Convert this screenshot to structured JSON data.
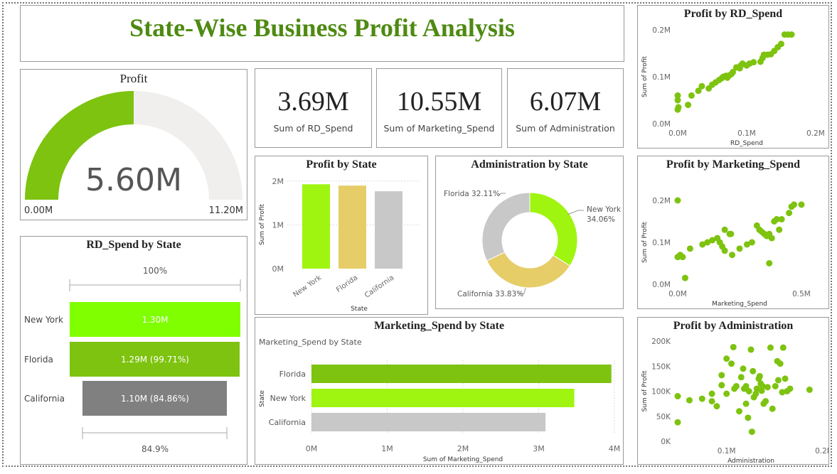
{
  "header": {
    "title": "State-Wise Business Profit Analysis"
  },
  "colors": {
    "accent": "#7dc30f",
    "bright_green": "#9ff510",
    "light_green": "#7fff00",
    "yellow": "#e6cd68",
    "gray": "#c8c8c8",
    "dark_gray": "#808080",
    "title_green": "#4e8a12"
  },
  "gauge": {
    "title": "Profit",
    "value_label": "5.60M",
    "min_label": "0.00M",
    "max_label": "11.20M",
    "fraction": 0.5
  },
  "kpis": [
    {
      "value": "3.69M",
      "label": "Sum of RD_Spend"
    },
    {
      "value": "10.55M",
      "label": "Sum of Marketing_Spend"
    },
    {
      "value": "6.07M",
      "label": "Sum of Administration"
    }
  ],
  "funnel": {
    "title": "RD_Spend by State",
    "top_label": "100%",
    "bottom_label": "84.9%",
    "rows": [
      {
        "state": "New York",
        "label": "1.30M",
        "fraction": 1.0
      },
      {
        "state": "Florida",
        "label": "1.29M (99.71%)",
        "fraction": 0.9971
      },
      {
        "state": "California",
        "label": "1.10M (84.86%)",
        "fraction": 0.8486
      }
    ]
  },
  "chart_data": [
    {
      "id": "profit_by_state",
      "type": "bar",
      "title": "Profit by State",
      "categories": [
        "New York",
        "Florida",
        "California"
      ],
      "values": [
        1.93,
        1.9,
        1.77
      ],
      "xlabel": "State",
      "ylabel": "Sum of Profit",
      "ylim": [
        0,
        2
      ],
      "yticks": [
        "0M",
        "1M",
        "2M"
      ],
      "colors": [
        "#9ff510",
        "#e6cd68",
        "#c8c8c8"
      ]
    },
    {
      "id": "admin_by_state",
      "type": "pie",
      "title": "Administration by State",
      "slices": [
        {
          "label": "New York",
          "percent": 34.06,
          "percent_label": "34.06%",
          "color": "#9ff510"
        },
        {
          "label": "California",
          "percent": 33.83,
          "percent_label": "California 33.83%",
          "color": "#e6cd68"
        },
        {
          "label": "Florida",
          "percent": 32.11,
          "percent_label": "Florida 32.11%",
          "color": "#c8c8c8"
        }
      ]
    },
    {
      "id": "marketing_by_state",
      "type": "bar",
      "orientation": "horizontal",
      "title": "Marketing_Spend by State",
      "subtitle": "Marketing_Spend by State",
      "categories": [
        "Florida",
        "New York",
        "California"
      ],
      "values": [
        3.96,
        3.47,
        3.09
      ],
      "xlabel": "Sum of Marketing_Spend",
      "ylabel": "State",
      "xlim": [
        0,
        4
      ],
      "xticks": [
        "0M",
        "1M",
        "2M",
        "3M",
        "4M"
      ],
      "colors": [
        "#7dc30f",
        "#9ff510",
        "#c8c8c8"
      ]
    },
    {
      "id": "profit_by_rd",
      "type": "scatter",
      "title": "Profit by RD_Spend",
      "xlabel": "RD_Spend",
      "ylabel": "Sum of Profit",
      "xlim": [
        0,
        0.2
      ],
      "ylim": [
        0,
        0.2
      ],
      "xticks": [
        "0.0M",
        "0.1M",
        "0.2M"
      ],
      "yticks": [
        "0.0M",
        "0.1M",
        "0.2M"
      ],
      "points": [
        [
          0,
          0.03
        ],
        [
          0,
          0.05
        ],
        [
          0,
          0.06
        ],
        [
          0.001,
          0.035
        ],
        [
          0.015,
          0.04
        ],
        [
          0.02,
          0.06
        ],
        [
          0.03,
          0.07
        ],
        [
          0.035,
          0.08
        ],
        [
          0.045,
          0.075
        ],
        [
          0.05,
          0.083
        ],
        [
          0.055,
          0.088
        ],
        [
          0.06,
          0.093
        ],
        [
          0.064,
          0.097
        ],
        [
          0.066,
          0.1
        ],
        [
          0.07,
          0.102
        ],
        [
          0.072,
          0.098
        ],
        [
          0.075,
          0.103
        ],
        [
          0.078,
          0.106
        ],
        [
          0.08,
          0.11
        ],
        [
          0.085,
          0.12
        ],
        [
          0.09,
          0.118
        ],
        [
          0.092,
          0.125
        ],
        [
          0.094,
          0.128
        ],
        [
          0.1,
          0.124
        ],
        [
          0.104,
          0.128
        ],
        [
          0.11,
          0.131
        ],
        [
          0.12,
          0.132
        ],
        [
          0.123,
          0.14
        ],
        [
          0.125,
          0.147
        ],
        [
          0.13,
          0.147
        ],
        [
          0.135,
          0.148
        ],
        [
          0.14,
          0.155
        ],
        [
          0.145,
          0.163
        ],
        [
          0.15,
          0.17
        ],
        [
          0.155,
          0.19
        ],
        [
          0.16,
          0.19
        ],
        [
          0.165,
          0.19
        ]
      ]
    },
    {
      "id": "profit_by_marketing",
      "type": "scatter",
      "title": "Profit by Marketing_Spend",
      "xlabel": "Marketing_Spend",
      "ylabel": "Sum of Profit",
      "xlim": [
        0,
        0.5
      ],
      "ylim": [
        0,
        0.2
      ],
      "xticks": [
        "0.0M",
        "0.5M"
      ],
      "yticks": [
        "0.0M",
        "0.1M",
        "0.2M"
      ],
      "points": [
        [
          0,
          0.2
        ],
        [
          0,
          0.065
        ],
        [
          0.01,
          0.07
        ],
        [
          0.02,
          0.065
        ],
        [
          0.03,
          0.015
        ],
        [
          0.05,
          0.085
        ],
        [
          0.1,
          0.095
        ],
        [
          0.12,
          0.1
        ],
        [
          0.14,
          0.105
        ],
        [
          0.16,
          0.11
        ],
        [
          0.17,
          0.1
        ],
        [
          0.18,
          0.09
        ],
        [
          0.19,
          0.13
        ],
        [
          0.19,
          0.08
        ],
        [
          0.21,
          0.12
        ],
        [
          0.215,
          0.12
        ],
        [
          0.22,
          0.07
        ],
        [
          0.25,
          0.085
        ],
        [
          0.28,
          0.095
        ],
        [
          0.3,
          0.1
        ],
        [
          0.32,
          0.14
        ],
        [
          0.33,
          0.13
        ],
        [
          0.34,
          0.125
        ],
        [
          0.35,
          0.12
        ],
        [
          0.36,
          0.115
        ],
        [
          0.37,
          0.12
        ],
        [
          0.37,
          0.05
        ],
        [
          0.38,
          0.11
        ],
        [
          0.39,
          0.15
        ],
        [
          0.4,
          0.155
        ],
        [
          0.41,
          0.13
        ],
        [
          0.42,
          0.155
        ],
        [
          0.45,
          0.17
        ],
        [
          0.46,
          0.185
        ],
        [
          0.47,
          0.19
        ],
        [
          0.5,
          0.19
        ]
      ]
    },
    {
      "id": "profit_by_admin",
      "type": "scatter",
      "title": "Profit by Administration",
      "xlabel": "Administration",
      "ylabel": "Sum of Profit",
      "xlim": [
        0.05,
        0.2
      ],
      "ylim": [
        0,
        200000
      ],
      "xticks": [
        "0.1M",
        "0.2M"
      ],
      "yticks": [
        "0K",
        "50K",
        "100K",
        "150K",
        "200K"
      ],
      "points": [
        [
          0.05,
          90000
        ],
        [
          0.05,
          38000
        ],
        [
          0.062,
          82000
        ],
        [
          0.075,
          85000
        ],
        [
          0.085,
          95000
        ],
        [
          0.085,
          80000
        ],
        [
          0.09,
          70000
        ],
        [
          0.095,
          132000
        ],
        [
          0.095,
          112000
        ],
        [
          0.1,
          165000
        ],
        [
          0.1,
          95000
        ],
        [
          0.105,
          155000
        ],
        [
          0.107,
          188000
        ],
        [
          0.108,
          105000
        ],
        [
          0.11,
          110000
        ],
        [
          0.113,
          60000
        ],
        [
          0.115,
          128000
        ],
        [
          0.117,
          145000
        ],
        [
          0.118,
          105000
        ],
        [
          0.12,
          110000
        ],
        [
          0.12,
          75000
        ],
        [
          0.122,
          47000
        ],
        [
          0.123,
          100000
        ],
        [
          0.125,
          183000
        ],
        [
          0.126,
          19000
        ],
        [
          0.127,
          140000
        ],
        [
          0.128,
          88000
        ],
        [
          0.13,
          95000
        ],
        [
          0.131,
          105000
        ],
        [
          0.133,
          125000
        ],
        [
          0.134,
          130000
        ],
        [
          0.135,
          115000
        ],
        [
          0.136,
          101000
        ],
        [
          0.137,
          110000
        ],
        [
          0.138,
          75000
        ],
        [
          0.14,
          80000
        ],
        [
          0.142,
          108000
        ],
        [
          0.145,
          187000
        ],
        [
          0.147,
          65000
        ],
        [
          0.15,
          110000
        ],
        [
          0.152,
          160000
        ],
        [
          0.153,
          122000
        ],
        [
          0.155,
          155000
        ],
        [
          0.157,
          98000
        ],
        [
          0.158,
          187000
        ],
        [
          0.16,
          125000
        ],
        [
          0.162,
          100000
        ],
        [
          0.165,
          105000
        ],
        [
          0.185,
          103000
        ]
      ]
    }
  ]
}
